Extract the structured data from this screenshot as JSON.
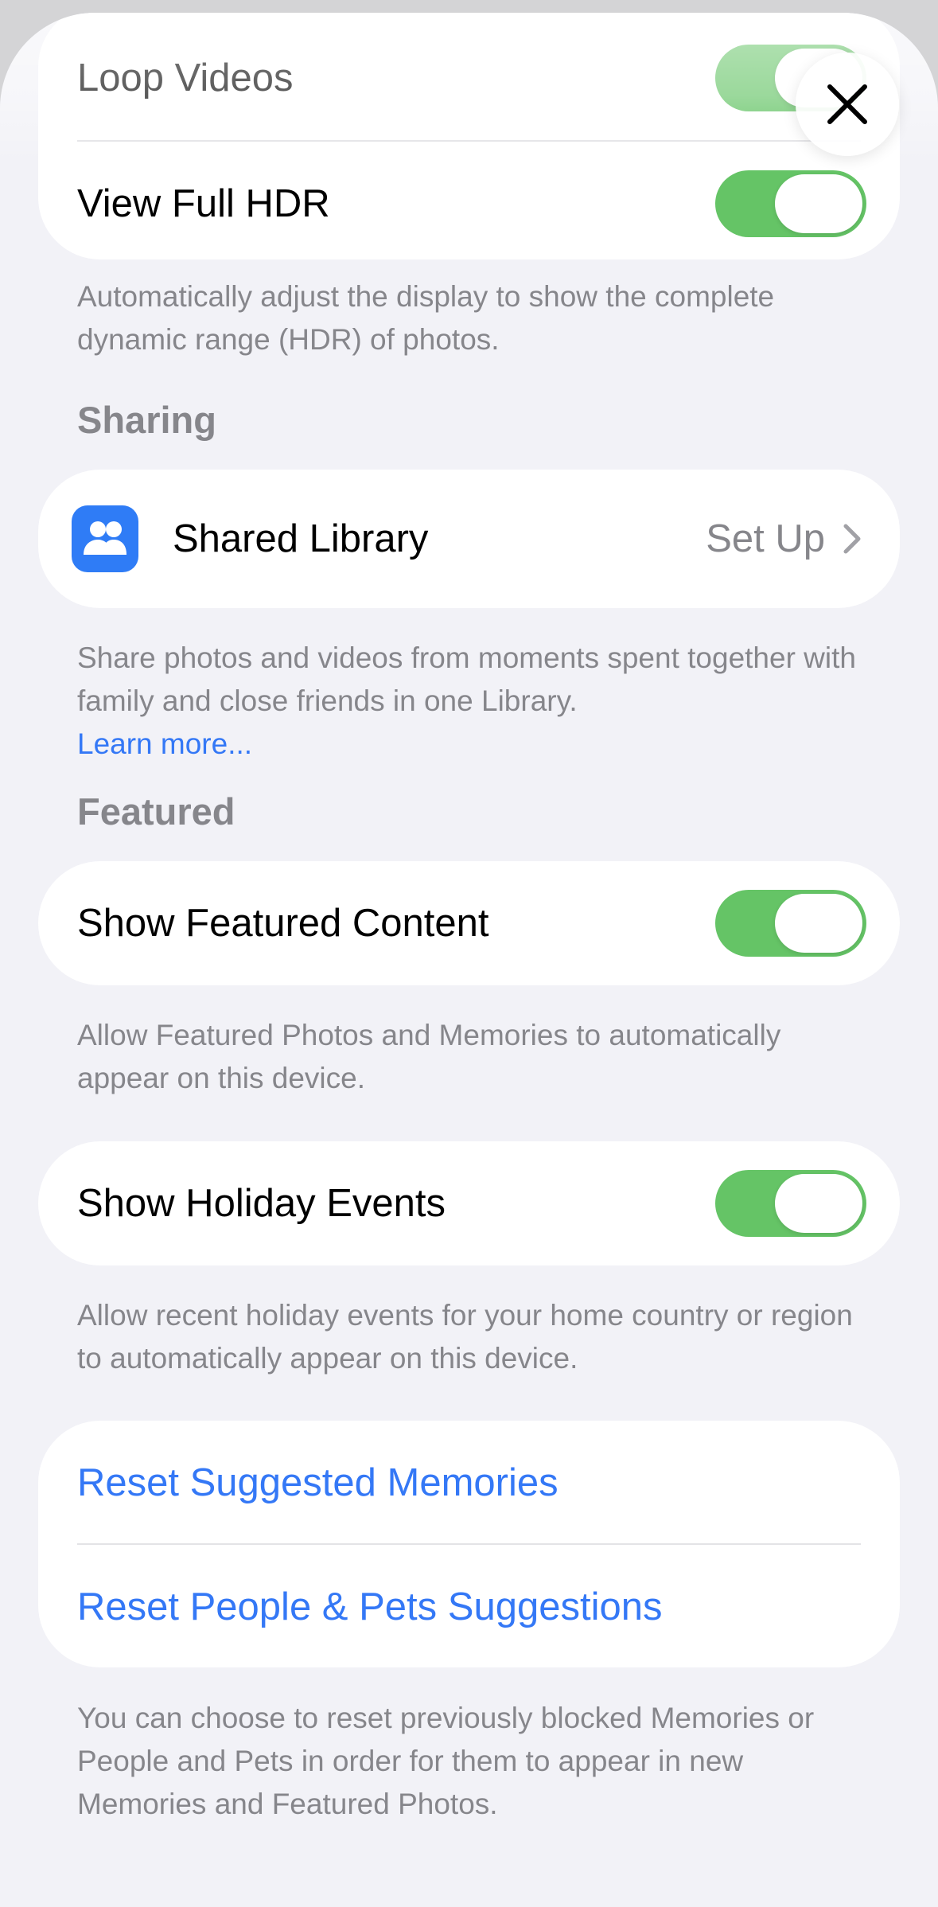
{
  "display_group": {
    "loop_videos_label": "Loop Videos",
    "loop_videos_on": true,
    "view_full_hdr_label": "View Full HDR",
    "view_full_hdr_on": true,
    "footnote": "Automatically adjust the display to show the complete dynamic range (HDR) of photos."
  },
  "sharing": {
    "header": "Sharing",
    "shared_library_label": "Shared Library",
    "shared_library_value": "Set Up",
    "icon": "people-icon",
    "footnote": "Share photos and videos from moments spent together with family and close friends in one Library.",
    "learn_more": "Learn more..."
  },
  "featured": {
    "header": "Featured",
    "show_featured_label": "Show Featured Content",
    "show_featured_on": true,
    "show_featured_footnote": "Allow Featured Photos and Memories to automatically appear on this device.",
    "holiday_label": "Show Holiday Events",
    "holiday_on": true,
    "holiday_footnote": "Allow recent holiday events for your home country or region to automatically appear on this device."
  },
  "reset": {
    "reset_memories_label": "Reset Suggested Memories",
    "reset_people_label": "Reset People & Pets Suggestions",
    "footnote": "You can choose to reset previously blocked Memories or People and Pets in order for them to appear in new Memories and Featured Photos."
  },
  "colors": {
    "accent": "#3478f6",
    "toggle_on": "#65c466",
    "secondary_text": "#86868b",
    "background": "#f2f2f7"
  },
  "close_button": {
    "icon": "close-icon"
  }
}
